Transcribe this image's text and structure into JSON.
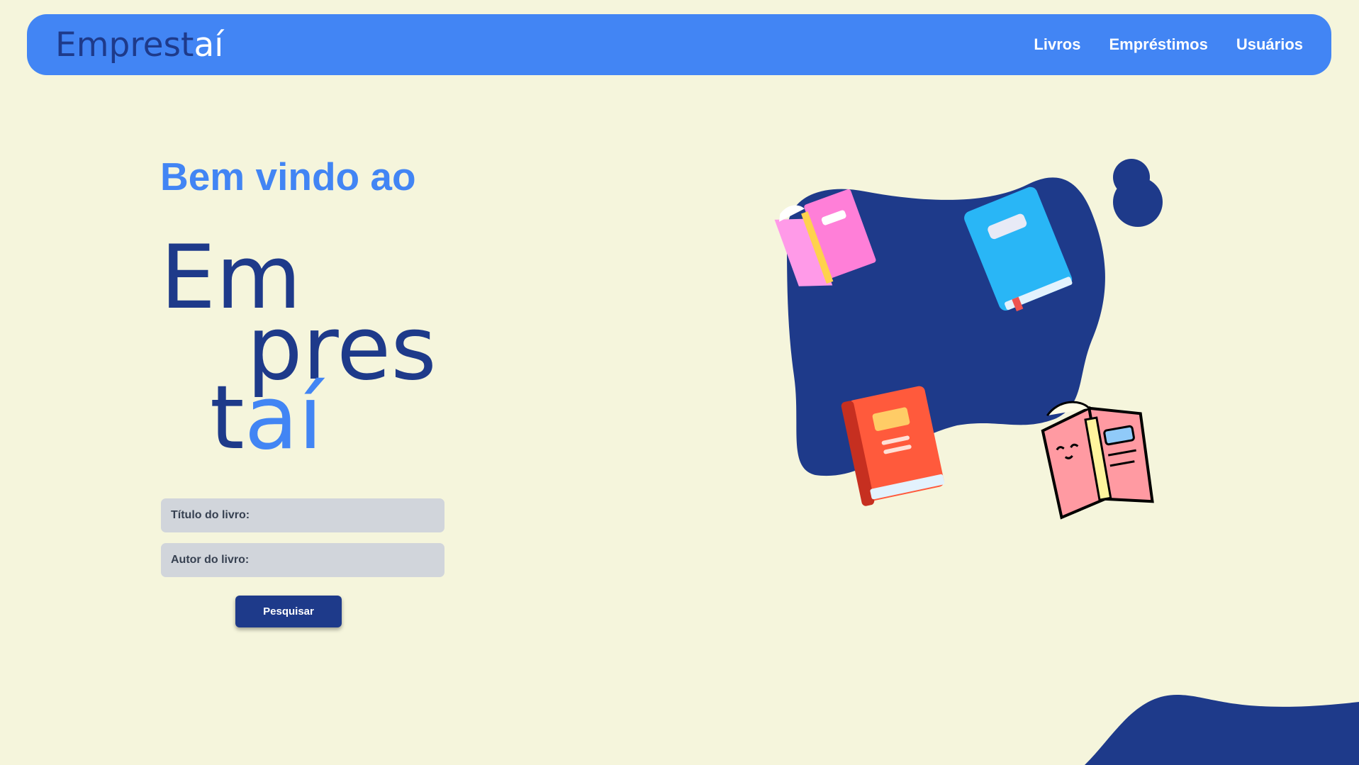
{
  "header": {
    "logo": {
      "dark_part": "Emprest",
      "light_part": "aí"
    },
    "nav": [
      {
        "label": "Livros"
      },
      {
        "label": "Empréstimos"
      },
      {
        "label": "Usuários"
      }
    ]
  },
  "hero": {
    "welcome": "Bem vindo ao",
    "logo": {
      "line1": "Em",
      "line2": "pres",
      "line3_dark": "t",
      "line3_accent": "aí"
    }
  },
  "search_form": {
    "title_placeholder": "Título do livro:",
    "author_placeholder": "Autor do livro:",
    "submit_label": "Pesquisar"
  },
  "colors": {
    "background": "#f5f5dc",
    "primary": "#4285f4",
    "navy": "#1e3a8a",
    "input": "#d1d5db"
  },
  "illustration": {
    "icons": [
      "pink-book-icon",
      "blue-book-icon",
      "red-book-icon",
      "reading-book-icon"
    ]
  }
}
